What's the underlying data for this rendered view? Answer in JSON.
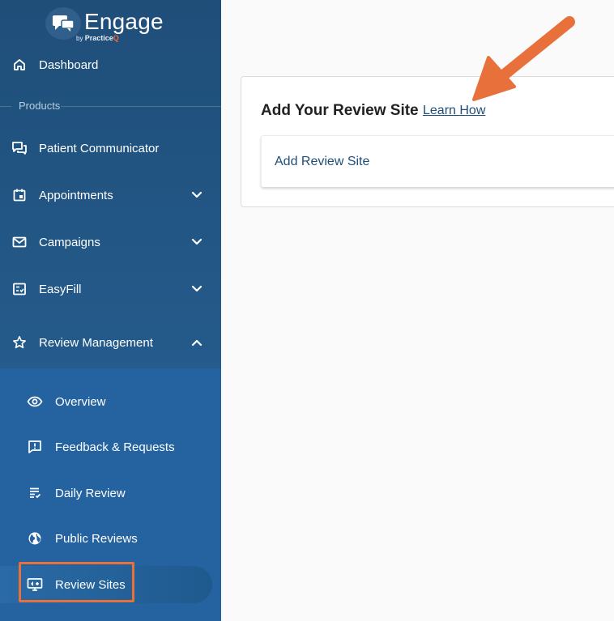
{
  "brand": {
    "name": "Engage",
    "by": "by",
    "parent_a": "Practice",
    "parent_b": "Q",
    "accent": "#f26b3a"
  },
  "sidebar": {
    "top_items": [
      {
        "label": "Dashboard",
        "icon": "home-icon"
      }
    ],
    "section_label": "Products",
    "items": [
      {
        "label": "Patient Communicator",
        "icon": "chat-icon",
        "expandable": false
      },
      {
        "label": "Appointments",
        "icon": "calendar-icon",
        "expandable": true,
        "expanded": false
      },
      {
        "label": "Campaigns",
        "icon": "mail-icon",
        "expandable": true,
        "expanded": false
      },
      {
        "label": "EasyFill",
        "icon": "checklist-icon",
        "expandable": true,
        "expanded": false
      },
      {
        "label": "Review Management",
        "icon": "star-icon",
        "expandable": true,
        "expanded": true
      }
    ],
    "subitems": [
      {
        "label": "Overview",
        "icon": "eye-icon"
      },
      {
        "label": "Feedback & Requests",
        "icon": "feedback-icon"
      },
      {
        "label": "Daily Review",
        "icon": "list-icon"
      },
      {
        "label": "Public Reviews",
        "icon": "globe-icon"
      },
      {
        "label": "Review Sites",
        "icon": "monitor-icon",
        "active": true
      }
    ]
  },
  "main": {
    "card_title": "Add Your Review Site",
    "learn_link": "Learn How",
    "add_label": "Add Review Site"
  },
  "colors": {
    "sidebar": "#1f4e79",
    "submenu": "#2563a0",
    "highlight": "#e8703a",
    "link": "#1f4e79"
  }
}
